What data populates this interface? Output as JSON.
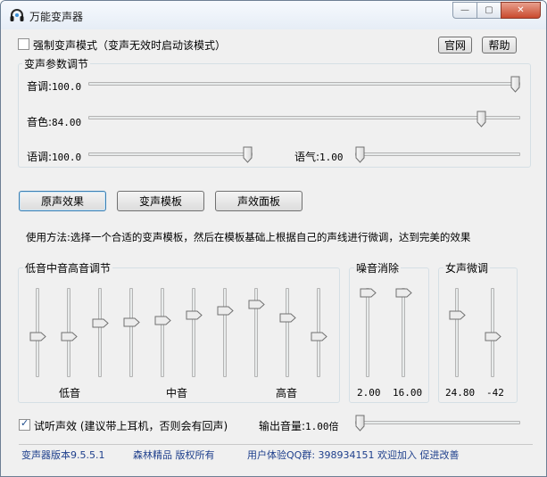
{
  "window": {
    "title": "万能变声器",
    "min_glyph": "—",
    "max_glyph": "▢",
    "close_glyph": "✕"
  },
  "top": {
    "force_mode_label": "强制变声模式（变声无效时启动该模式）",
    "force_mode_checked": false,
    "website_label": "官网",
    "help_label": "帮助"
  },
  "params": {
    "group_label": "变声参数调节",
    "pitch": {
      "label": "音调:",
      "value": "100.0",
      "fraction": 1.0
    },
    "timbre": {
      "label": "音色:",
      "value": "84.00",
      "fraction": 0.92
    },
    "speed": {
      "label": "语调:",
      "value": "100.0",
      "fraction": 1.0
    },
    "breath": {
      "label": "语气:",
      "value": "1.00",
      "fraction": 0.0
    }
  },
  "buttons": {
    "original": "原声效果",
    "templates": "变声模板",
    "effects": "声效面板"
  },
  "usage": "使用方法:选择一个合适的变声模板，然后在模板基础上根据自己的声线进行微调，达到完美的效果",
  "eq": {
    "group_label": "低音中音高音调节",
    "levels": [
      0.55,
      0.55,
      0.38,
      0.37,
      0.35,
      0.28,
      0.22,
      0.15,
      0.32,
      0.55
    ],
    "low_label": "低音",
    "mid_label": "中音",
    "high_label": "高音"
  },
  "noise": {
    "group_label": "噪音消除",
    "sliders": [
      {
        "value": "2.00",
        "fraction": 0.0
      },
      {
        "value": "16.00",
        "fraction": 0.0
      }
    ]
  },
  "female": {
    "group_label": "女声微调",
    "sliders": [
      {
        "value": "24.80",
        "fraction": 0.28
      },
      {
        "value": "-42",
        "fraction": 0.55
      }
    ]
  },
  "bottom": {
    "monitor_label": "试听声效 (建议带上耳机，否则会有回声)",
    "monitor_checked": true,
    "volume_label": "输出音量:",
    "volume_value": "1.00倍",
    "volume_fraction": 0.0
  },
  "status": {
    "version": "变声器版本9.5.5.1",
    "copyright": "森林精品 版权所有",
    "qq_group": "用户体验QQ群: 398934151 欢迎加入 促进改善"
  }
}
